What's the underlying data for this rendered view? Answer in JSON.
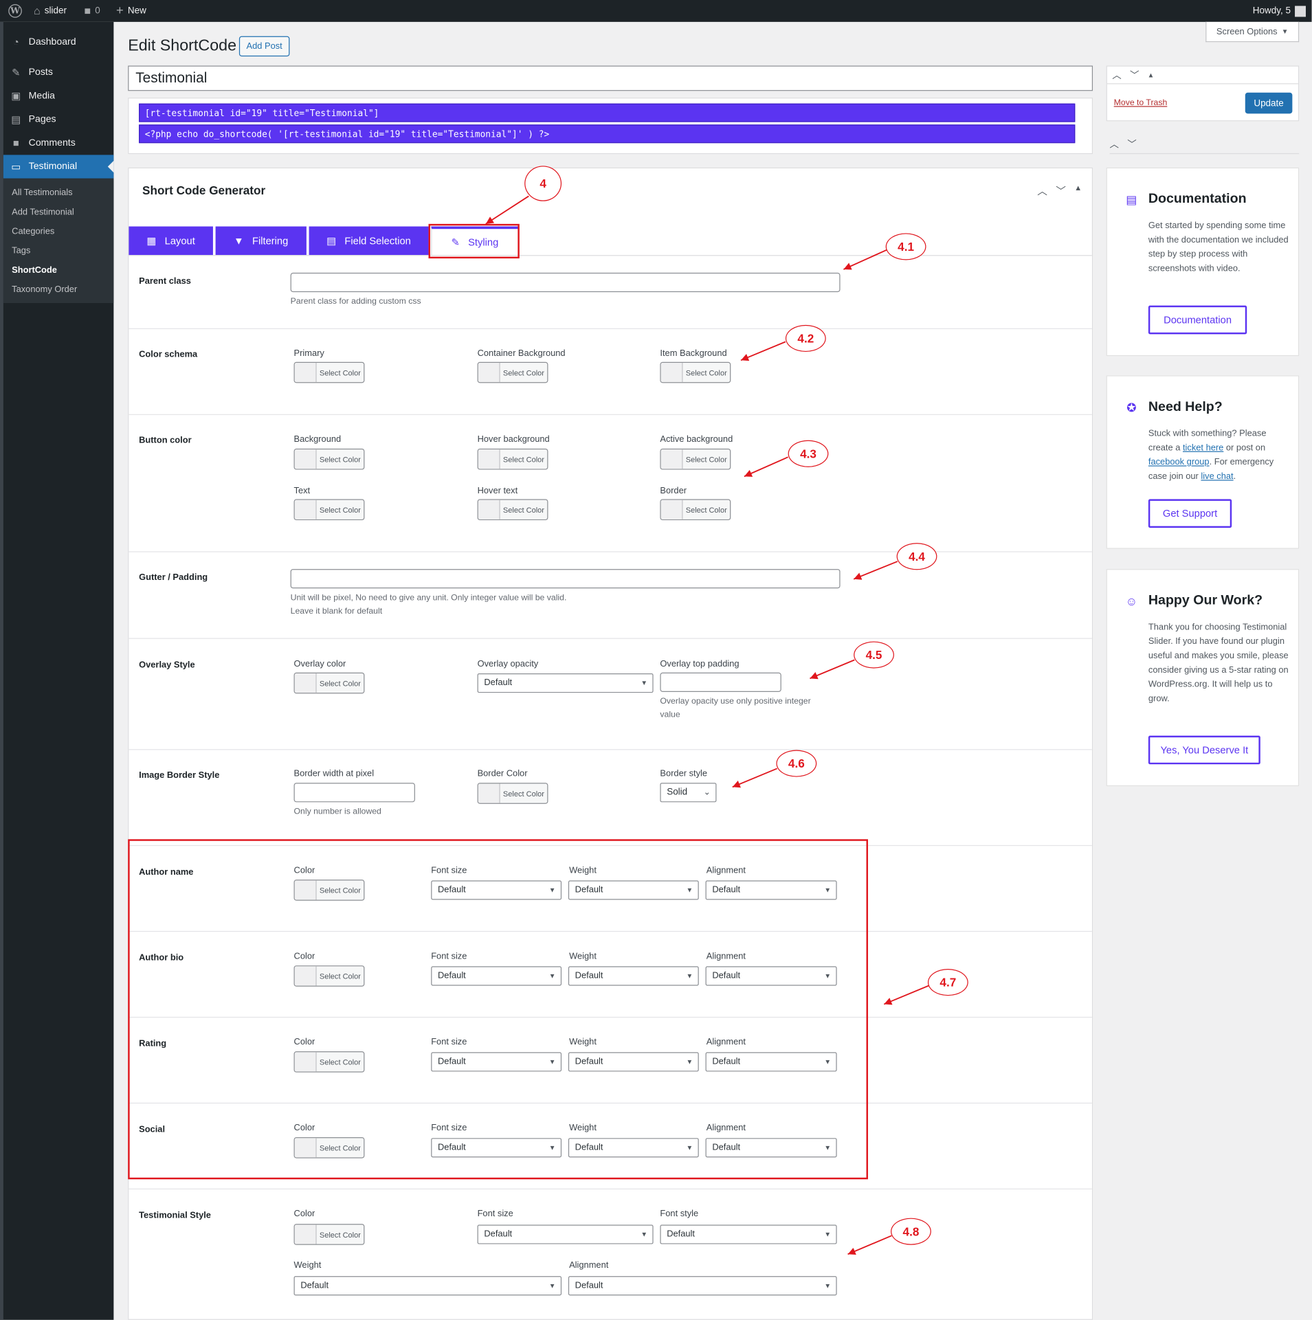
{
  "adminbar": {
    "site_name": "slider",
    "comments_count": "0",
    "new_label": "New",
    "howdy": "Howdy, 5"
  },
  "sidebar": {
    "items": [
      {
        "label": "Dashboard",
        "icon": "dashboard-icon"
      },
      {
        "label": "Posts",
        "icon": "pin-icon"
      },
      {
        "label": "Media",
        "icon": "media-icon"
      },
      {
        "label": "Pages",
        "icon": "pages-icon"
      },
      {
        "label": "Comments",
        "icon": "comment-icon"
      },
      {
        "label": "Testimonial",
        "icon": "testimonial-icon"
      }
    ],
    "submenu": [
      "All Testimonials",
      "Add Testimonial",
      "Categories",
      "Tags",
      "ShortCode",
      "Taxonomy Order"
    ]
  },
  "header": {
    "title": "Edit ShortCode",
    "add_post": "Add Post",
    "screen_options": "Screen Options"
  },
  "post_title": "Testimonial",
  "shortcodes": {
    "line1": "[rt-testimonial id=\"19\" title=\"Testimonial\"]",
    "line2": "<?php echo do_shortcode( '[rt-testimonial id=\"19\" title=\"Testimonial\"]' ) ?>"
  },
  "generator": {
    "title": "Short Code Generator",
    "tabs": [
      "Layout",
      "Filtering",
      "Field Selection",
      "Styling"
    ]
  },
  "common": {
    "select_color": "Select Color",
    "default": "Default",
    "solid": "Solid"
  },
  "styling": {
    "parent_class": {
      "label": "Parent class",
      "desc": "Parent class for adding custom css"
    },
    "color_schema": {
      "label": "Color schema",
      "fields": [
        "Primary",
        "Container Background",
        "Item Background"
      ]
    },
    "button_color": {
      "label": "Button color",
      "fields": [
        "Background",
        "Hover background",
        "Active background",
        "Text",
        "Hover text",
        "Border"
      ]
    },
    "gutter": {
      "label": "Gutter / Padding",
      "desc1": "Unit will be pixel, No need to give any unit. Only integer value will be valid.",
      "desc2": "Leave it blank for default"
    },
    "overlay": {
      "label": "Overlay Style",
      "color": "Overlay color",
      "opacity": "Overlay opacity",
      "padding": "Overlay top padding",
      "padding_desc1": "Overlay opacity use only positive integer",
      "padding_desc2": "value"
    },
    "image_border": {
      "label": "Image Border Style",
      "width": "Border width at pixel",
      "width_desc": "Only number is allowed",
      "color": "Border Color",
      "style": "Border style"
    },
    "typo_rows": [
      {
        "label": "Author name"
      },
      {
        "label": "Author bio"
      },
      {
        "label": "Rating"
      },
      {
        "label": "Social"
      }
    ],
    "typo_fields": {
      "color": "Color",
      "font_size": "Font size",
      "weight": "Weight",
      "alignment": "Alignment"
    },
    "testimonial_style": {
      "label": "Testimonial Style",
      "color": "Color",
      "font_size": "Font size",
      "font_style": "Font style",
      "weight": "Weight",
      "alignment": "Alignment"
    }
  },
  "publish": {
    "move_to_trash": "Move to Trash",
    "update": "Update"
  },
  "cards": {
    "documentation": {
      "title": "Documentation",
      "text": "Get started by spending some time with the documentation we included step by step process with screenshots with video.",
      "button": "Documentation"
    },
    "help": {
      "title": "Need Help?",
      "t1": "Stuck with something? Please create a",
      "link1": "ticket here",
      "t2": "or post on",
      "link2": "facebook group",
      "t3": ". For emergency case join our",
      "link3": "live chat",
      "t4": ".",
      "button": "Get Support"
    },
    "happy": {
      "title": "Happy Our Work?",
      "text": "Thank you for choosing Testimonial Slider. If you have found our plugin useful and makes you smile, please consider giving us a 5-star rating on WordPress.org. It will help us to grow.",
      "button": "Yes, You Deserve It"
    }
  },
  "annotations": [
    "4",
    "4.1",
    "4.2",
    "4.3",
    "4.4",
    "4.5",
    "4.6",
    "4.7",
    "4.8"
  ],
  "colors": {
    "accent": "#5b34f1",
    "wp_blue": "#2271b1",
    "annotation": "#e0161d"
  }
}
